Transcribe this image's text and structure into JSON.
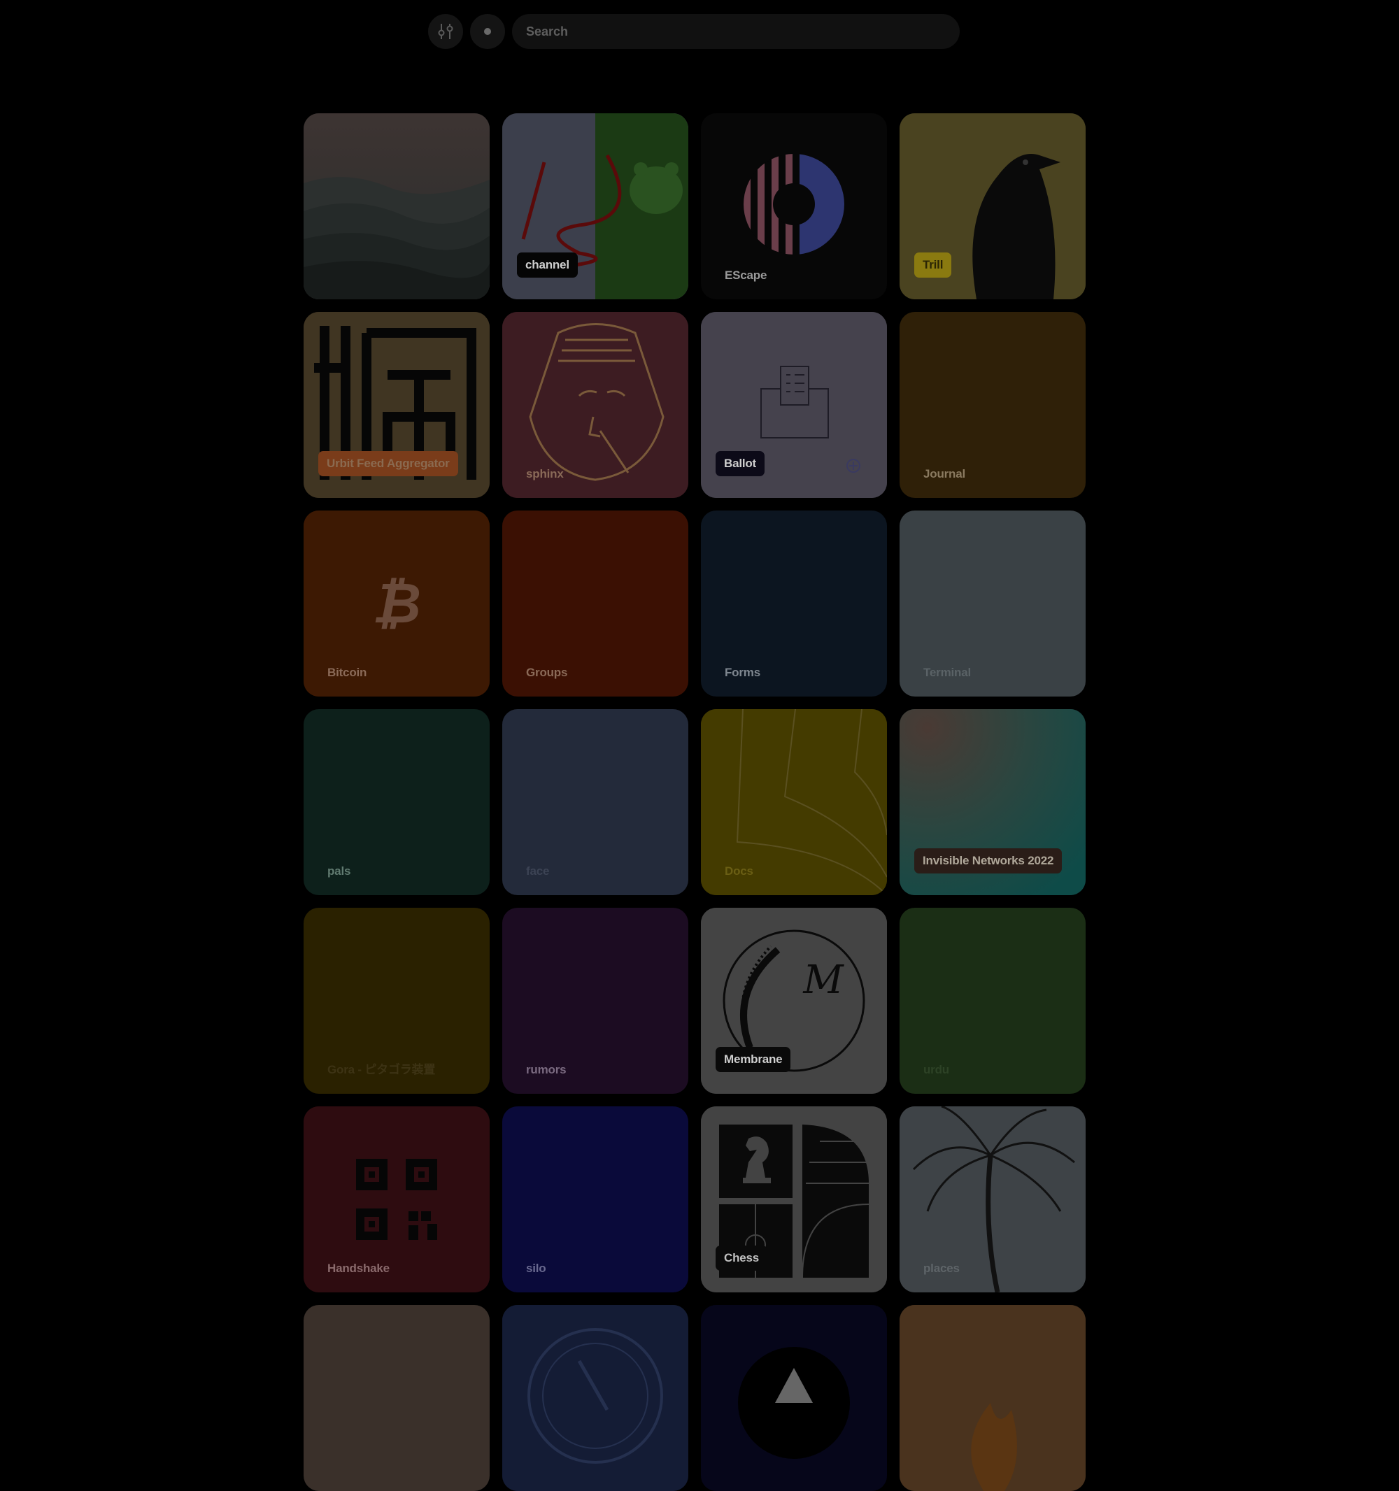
{
  "search": {
    "placeholder": "Search"
  },
  "toolbar": {
    "filter_icon": "sliders-icon",
    "dot_icon": "dot-icon"
  },
  "tiles": [
    {
      "label": "",
      "bg": "#2a2a2a",
      "art": "mountains"
    },
    {
      "label": "channel",
      "bg": "#3c3f4c",
      "art": "bear",
      "pill": true,
      "pill_bg": "#050505",
      "color": "#cfcfcf"
    },
    {
      "label": "EScape",
      "bg": "#070707",
      "art": "escape",
      "color": "#9a9a9a"
    },
    {
      "label": "Trill",
      "bg": "#4a4320",
      "art": "crow",
      "pill": true,
      "pill_bg": "#8a7a10",
      "color": "#2a2504"
    },
    {
      "label": "Urbit Feed Aggregator",
      "bg": "#403522",
      "art": "kanji",
      "pill": true,
      "pill_bg": "#7a3c1a",
      "color": "#8a6a50"
    },
    {
      "label": "sphinx",
      "bg": "#3d1c22",
      "art": "sphinx",
      "color": "#8a6a58"
    },
    {
      "label": "Ballot",
      "bg": "#45424d",
      "art": "ballot",
      "pill": true,
      "pill_bg": "#0c0a18",
      "color": "#cfcfcf"
    },
    {
      "label": "Journal",
      "bg": "#2f2008",
      "color": "#8a7a60"
    },
    {
      "label": "Bitcoin",
      "bg": "#3d1903",
      "art": "bitcoin",
      "color": "#8a6a58"
    },
    {
      "label": "Groups",
      "bg": "#3b1003",
      "color": "#8a6a58"
    },
    {
      "label": "Forms",
      "bg": "#0c1520",
      "color": "#7f8790"
    },
    {
      "label": "Terminal",
      "bg": "#3a4145",
      "color": "#5a6266"
    },
    {
      "label": "pals",
      "bg": "#0d201b",
      "color": "#607a70"
    },
    {
      "label": "face",
      "bg": "#232a3a",
      "color": "#3c4354"
    },
    {
      "label": "Docs",
      "bg": "#443b00",
      "art": "docs",
      "color": "#6a5e14"
    },
    {
      "label": "Invisible Networks 2022",
      "bg": "#14403e",
      "art": "gradient",
      "pill": true,
      "pill_bg": "#2a1d18",
      "color": "#b0a89a"
    },
    {
      "label": "Gora - ピタゴラ装置",
      "bg": "#2a2100",
      "color": "#3d3314"
    },
    {
      "label": "rumors",
      "bg": "#1c0c22",
      "color": "#7a6a80"
    },
    {
      "label": "Membrane",
      "bg": "#444444",
      "art": "membrane",
      "pill": true,
      "pill_bg": "#0a0a0a",
      "color": "#cfcfcf"
    },
    {
      "label": "urdu",
      "bg": "#1b2e15",
      "color": "#2d4226"
    },
    {
      "label": "Handshake",
      "bg": "#2e0c10",
      "art": "qr",
      "color": "#8a6a6c"
    },
    {
      "label": "silo",
      "bg": "#0a0a3a",
      "color": "#6a6a90"
    },
    {
      "label": "Chess",
      "bg": "#434343",
      "art": "chess",
      "pill": true,
      "pill_bg": "#0a0a0a",
      "color": "#c0c0c0"
    },
    {
      "label": "places",
      "bg": "#3e4347",
      "art": "palm",
      "color": "#5e6468"
    },
    {
      "label": "",
      "bg": "#3a302a"
    },
    {
      "label": "",
      "bg": "#141c35",
      "art": "compass"
    },
    {
      "label": "",
      "bg": "#06061a",
      "art": "triangle"
    },
    {
      "label": "",
      "bg": "#4a331e",
      "art": "flame"
    }
  ]
}
